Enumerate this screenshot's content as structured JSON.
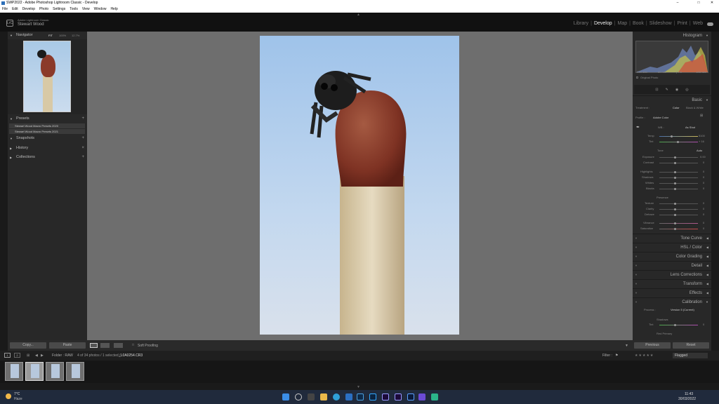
{
  "window": {
    "title": "SWP2022 - Adobe Photoshop Lightroom Classic - Develop",
    "minimize": "–",
    "maximize": "□",
    "close": "✕"
  },
  "menu": [
    "File",
    "Edit",
    "Develop",
    "Photo",
    "Settings",
    "Tools",
    "View",
    "Window",
    "Help"
  ],
  "identity": {
    "app": "Adobe Lightroom Classic",
    "user": "Stewart Wood",
    "logo": "LrC"
  },
  "modules": [
    "Library",
    "Develop",
    "Map",
    "Book",
    "Slideshow",
    "Print",
    "Web"
  ],
  "left_panel": {
    "navigator": {
      "title": "Navigator",
      "zoom": [
        "FIT",
        "100%",
        "12.7%"
      ]
    },
    "presets": {
      "title": "Presets",
      "items": [
        "Stewart Wood Macro Presets 2020",
        "Stewart Wood Macro Presets 2021"
      ]
    },
    "snapshots": "Snapshots",
    "history": "History",
    "collections": "Collections",
    "copy": "Copy...",
    "paste": "Paste"
  },
  "toolbar": {
    "soft_proofing": "Soft Proofing"
  },
  "right_panel": {
    "histogram": {
      "title": "Histogram",
      "iso": "ISO 400",
      "focal": "60 mm",
      "aperture": "ƒ / 8",
      "shutter": "1/60 sec",
      "original": "Original Photo"
    },
    "basic": {
      "title": "Basic",
      "treatment": "Treatment :",
      "color": "Color",
      "bw": "Black & White",
      "profile": "Profile :",
      "profile_value": "Adobe Color",
      "wb": "WB :",
      "wb_value": "As Shot",
      "temp": "Temp",
      "temp_value": "5100",
      "tint": "Tint",
      "tint_value": "+ 16",
      "tone": "Tone",
      "auto": "Auto",
      "tone_sliders": [
        {
          "label": "Exposure",
          "value": "0.00"
        },
        {
          "label": "Contrast",
          "value": "0"
        },
        {
          "label": "Highlights",
          "value": "0"
        },
        {
          "label": "Shadows",
          "value": "0"
        },
        {
          "label": "Whites",
          "value": "0"
        },
        {
          "label": "Blacks",
          "value": "0"
        }
      ],
      "presence": "Presence",
      "presence_sliders": [
        {
          "label": "Texture",
          "value": "0"
        },
        {
          "label": "Clarity",
          "value": "0"
        },
        {
          "label": "Dehaze",
          "value": "0"
        },
        {
          "label": "Vibrance",
          "value": "0"
        },
        {
          "label": "Saturation",
          "value": "0"
        }
      ]
    },
    "sections": [
      "Tone Curve",
      "HSL / Color",
      "Color Grading",
      "Detail",
      "Lens Corrections",
      "Transform",
      "Effects",
      "Calibration"
    ],
    "calibration": {
      "process": "Process :",
      "version": "Version 5 (Current)",
      "shadows": "Shadows",
      "tint": "Tint",
      "tint_value": "0",
      "red_primary": "Red Primary"
    },
    "previous": "Previous",
    "reset": "Reset"
  },
  "filmbar": {
    "folder": "Folder : RAW",
    "count": "4 of 34 photos / 1 selected /",
    "filename": "_L0A0254.CR3",
    "filter_label": "Filter :",
    "flagged": "Flagged",
    "page_1": "1",
    "page_2": "2"
  },
  "taskbar": {
    "weather_temp": "7°C",
    "weather_desc": "Haze",
    "time": "11:43",
    "date": "30/03/2022"
  },
  "colors": {
    "accent": "#ffffff",
    "panel": "#282828",
    "canvas": "#6e6e6e"
  }
}
